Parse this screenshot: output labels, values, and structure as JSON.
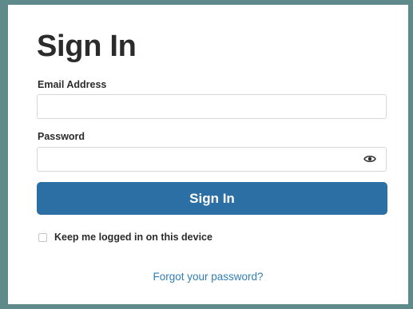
{
  "signin": {
    "title": "Sign In",
    "email": {
      "label": "Email Address",
      "value": ""
    },
    "password": {
      "label": "Password",
      "value": "",
      "toggle_icon": "eye-icon"
    },
    "submit_label": "Sign In",
    "remember_label": "Keep me logged in on this device",
    "remember_checked": false,
    "forgot_label": "Forgot your password?"
  },
  "colors": {
    "background": "#5f8a8b",
    "card": "#ffffff",
    "primary_button": "#2c6fa4",
    "link": "#2f7fb5",
    "text": "#2b2b2b"
  }
}
